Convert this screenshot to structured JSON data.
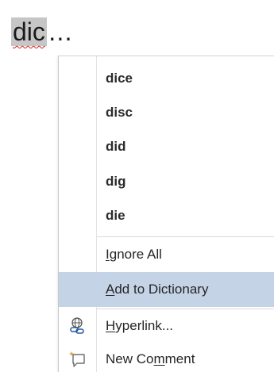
{
  "document": {
    "word": "dic",
    "trailing": "…",
    "misspelled": true
  },
  "context_menu": {
    "suggestions": [
      {
        "label": "dice"
      },
      {
        "label": "disc"
      },
      {
        "label": "did"
      },
      {
        "label": "dig"
      },
      {
        "label": "die"
      }
    ],
    "ignore_all": {
      "before": "",
      "accel": "I",
      "after": "gnore All"
    },
    "add_to_dictionary": {
      "before": "",
      "accel": "A",
      "after": "dd to Dictionary",
      "hovered": true
    },
    "hyperlink": {
      "before": "",
      "accel": "H",
      "after": "yperlink...",
      "icon": "hyperlink-icon"
    },
    "new_comment": {
      "before": "New Co",
      "accel": "m",
      "after": "ment",
      "icon": "new-comment-icon"
    }
  },
  "colors": {
    "hover_bg": "#c5d3e7",
    "selection_bg": "#c6c6c6",
    "spell_underline": "#d21f1f"
  }
}
